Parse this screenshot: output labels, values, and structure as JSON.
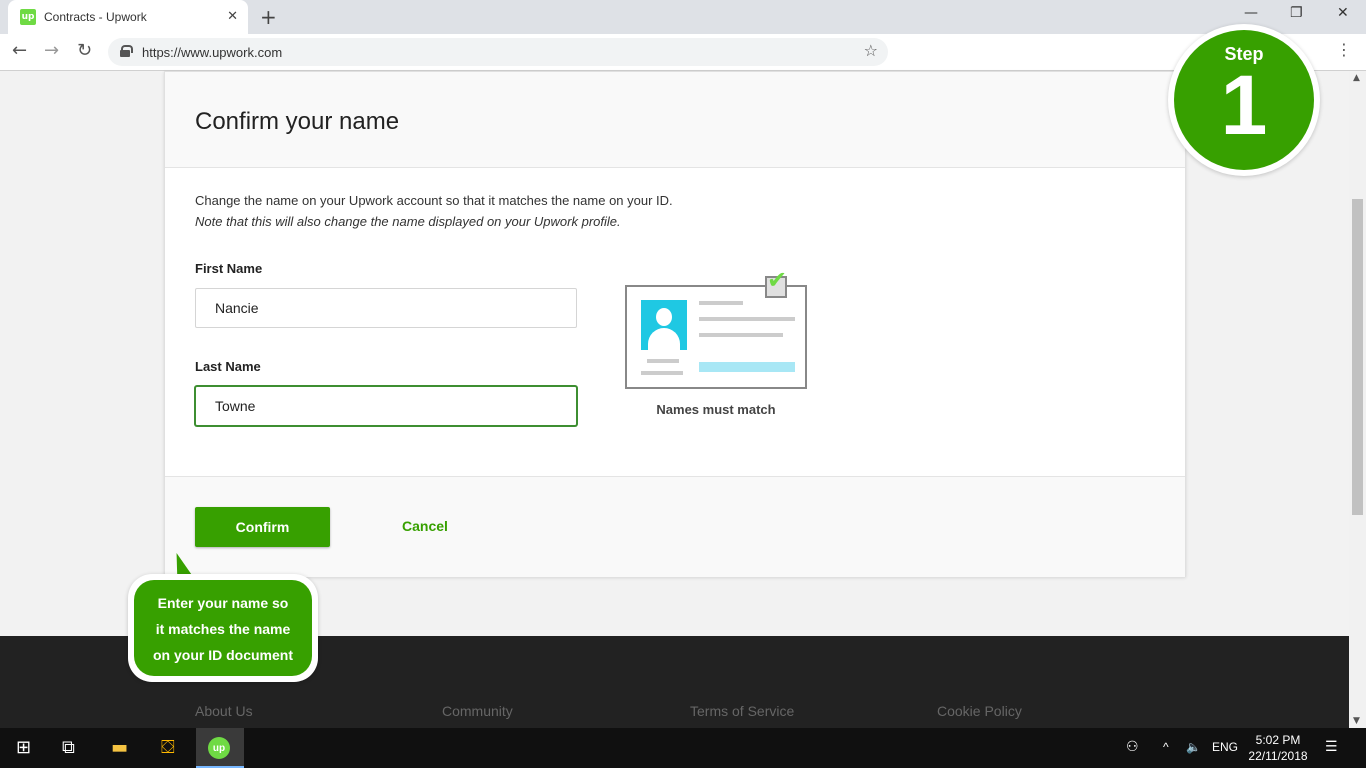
{
  "browser": {
    "tab_title": "Contracts - Upwork",
    "favicon_text": "up",
    "url": "https://www.upwork.com"
  },
  "dialog": {
    "title": "Confirm your name",
    "description": "Change the name on your Upwork account so that it matches the name on your ID.",
    "note": "Note that this will also change the name displayed on your Upwork profile.",
    "first_name_label": "First Name",
    "first_name_value": "Nancie",
    "last_name_label": "Last Name",
    "last_name_value": "Towne",
    "illustration_caption": "Names must match",
    "confirm_label": "Confirm",
    "cancel_label": "Cancel"
  },
  "tooltip": {
    "line1": "Enter your name so",
    "line2": "it matches the name",
    "line3": "on your ID document"
  },
  "step_badge": {
    "label": "Step",
    "number": "1"
  },
  "footer": {
    "links": [
      "About Us",
      "Community",
      "Terms of Service",
      "Cookie Policy"
    ]
  },
  "taskbar": {
    "language": "ENG",
    "time": "5:02 PM",
    "date": "22/11/2018"
  },
  "colors": {
    "brand_green": "#37a000",
    "upwork_light_green": "#6fda44",
    "avatar_cyan": "#1fc8e3"
  }
}
